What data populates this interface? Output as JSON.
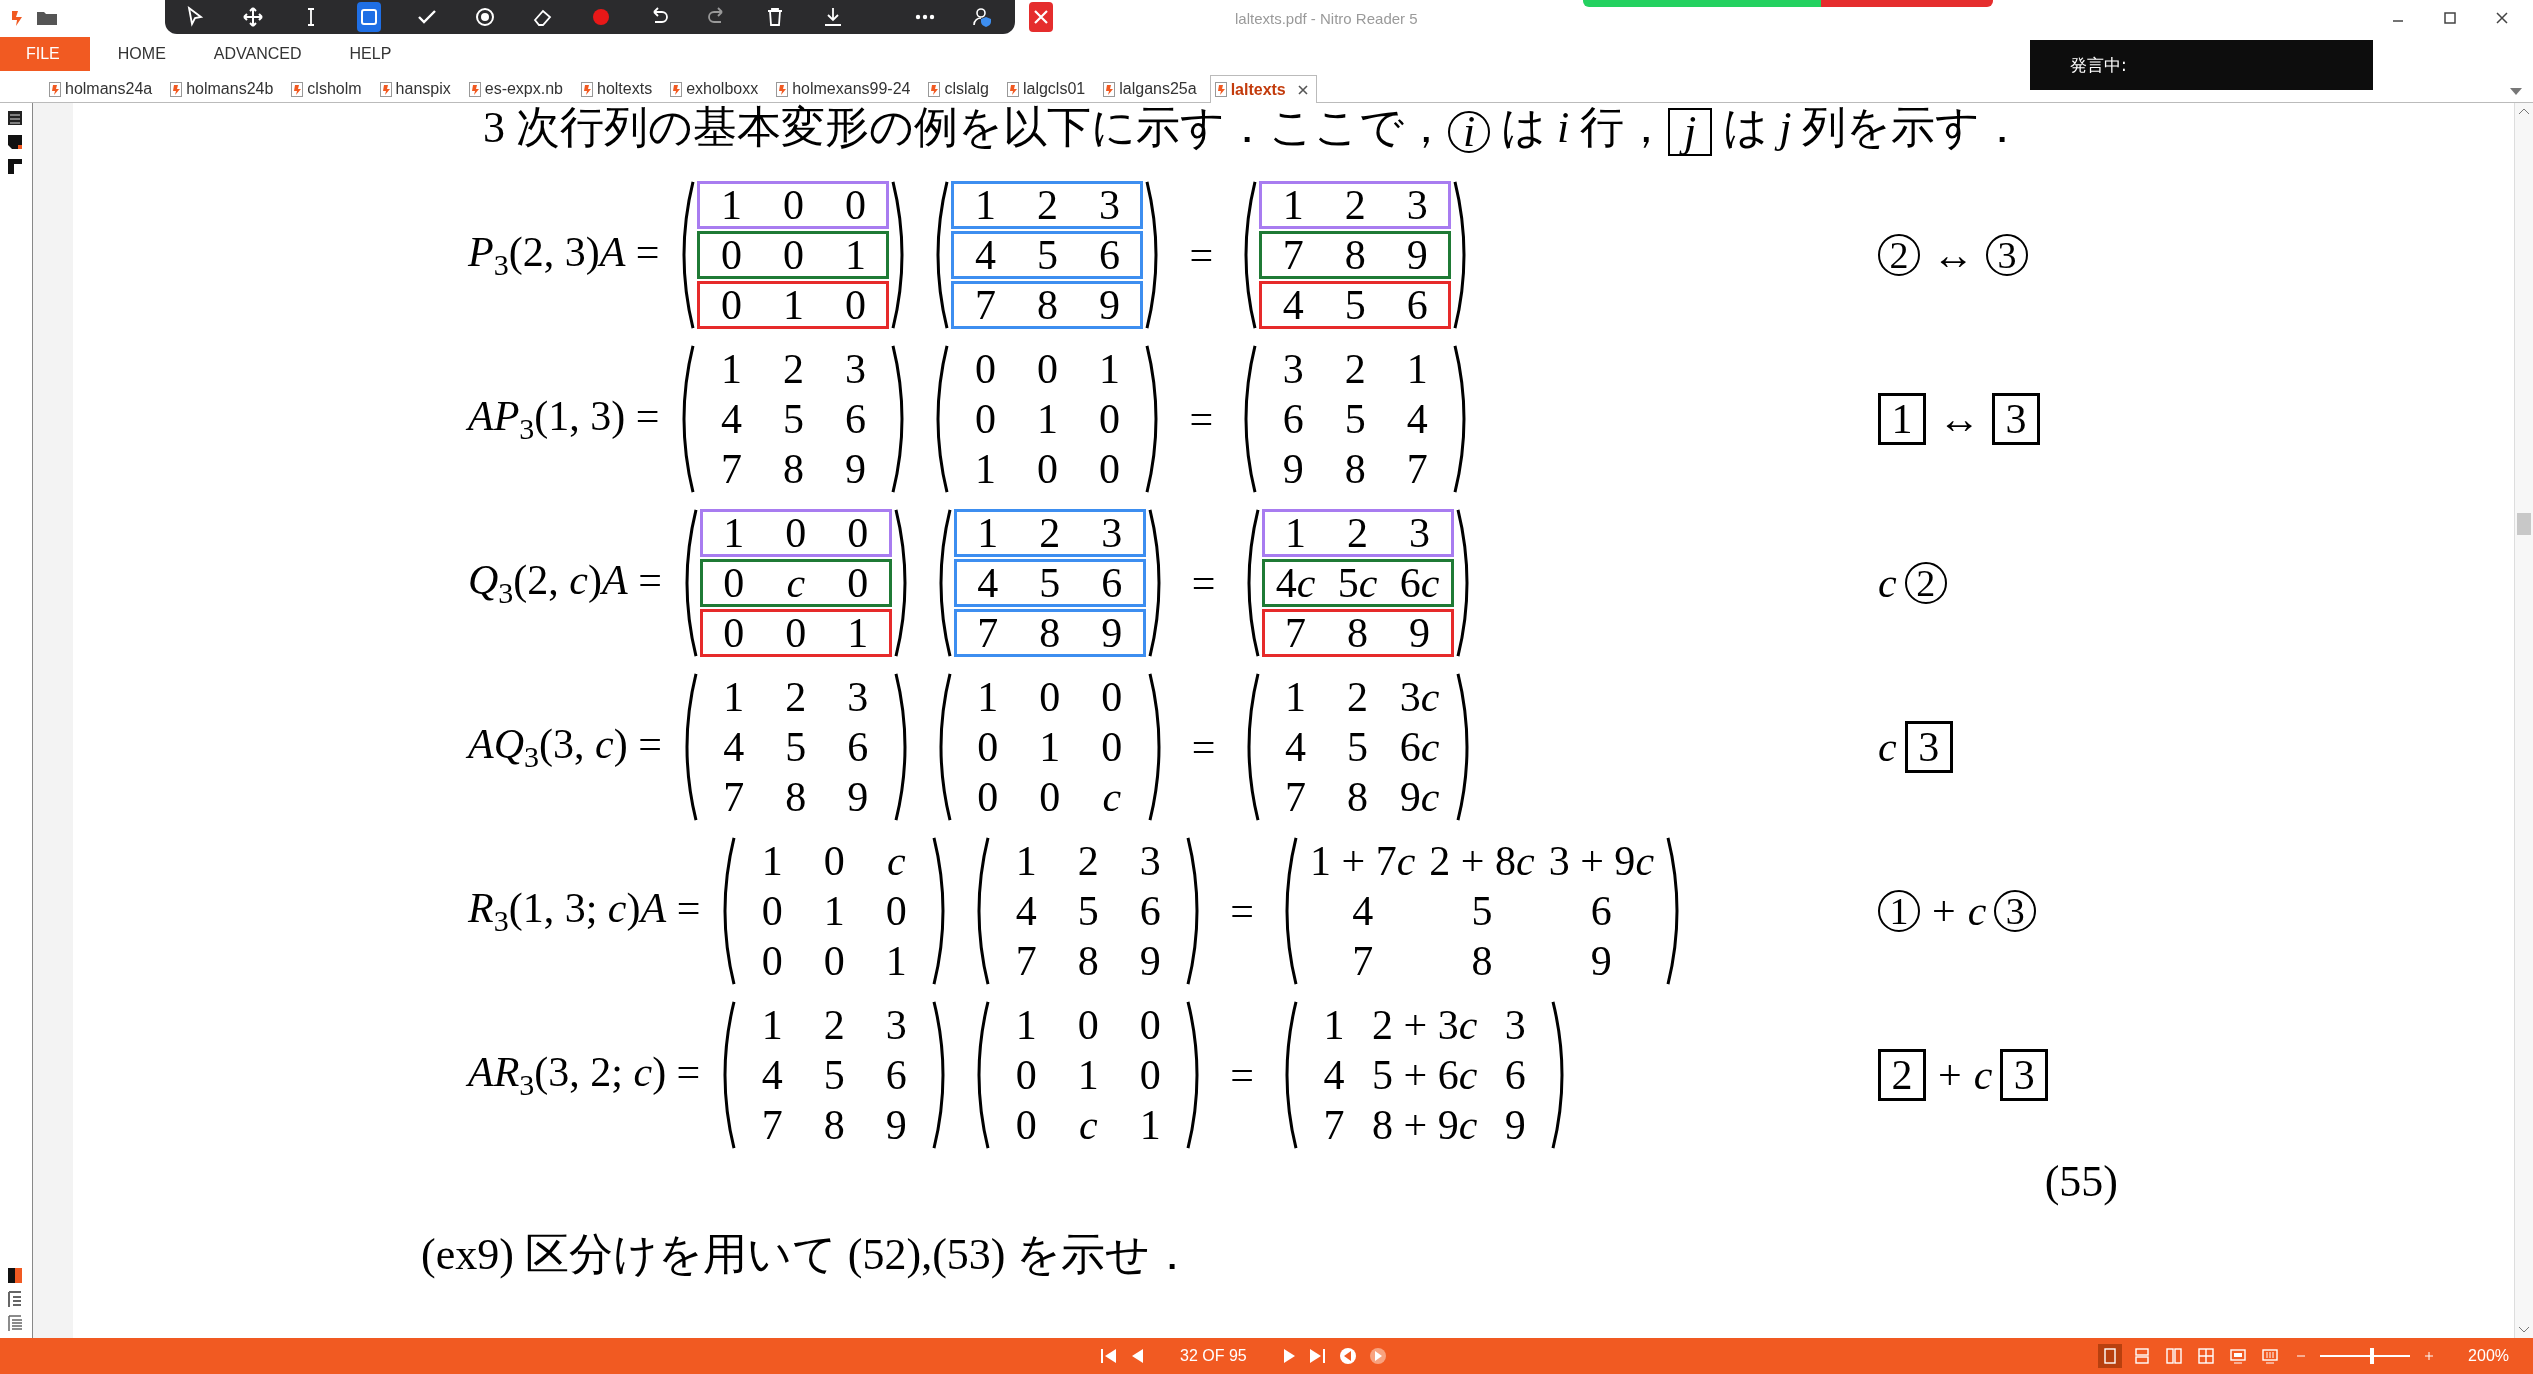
{
  "window": {
    "title": "laltexts.pdf - Nitro Reader 5"
  },
  "floating_toolbar": [
    {
      "kind": "pointer",
      "selected": false
    },
    {
      "kind": "move",
      "selected": false
    },
    {
      "kind": "text",
      "selected": false
    },
    {
      "kind": "rectangle",
      "selected": true
    },
    {
      "kind": "check",
      "selected": false
    },
    {
      "kind": "target",
      "selected": false
    },
    {
      "kind": "eraser",
      "selected": false
    },
    {
      "kind": "dot",
      "selected": false
    },
    {
      "kind": "undo",
      "selected": false
    },
    {
      "kind": "redo",
      "selected": false
    },
    {
      "kind": "trash",
      "selected": false
    },
    {
      "kind": "download",
      "selected": false
    },
    {
      "kind": "more",
      "selected": false
    },
    {
      "kind": "user",
      "selected": false
    }
  ],
  "menu": [
    {
      "label": "FILE",
      "selected": true
    },
    {
      "label": "HOME",
      "selected": false
    },
    {
      "label": "ADVANCED",
      "selected": false
    },
    {
      "label": "HELP",
      "selected": false
    }
  ],
  "tabs": [
    {
      "label": "holmans24a",
      "selected": false
    },
    {
      "label": "holmans24b",
      "selected": false
    },
    {
      "label": "clsholm",
      "selected": false
    },
    {
      "label": "hanspix",
      "selected": false
    },
    {
      "label": "es-expx.nb",
      "selected": false
    },
    {
      "label": "holtexts",
      "selected": false
    },
    {
      "label": "exholboxx",
      "selected": false
    },
    {
      "label": "holmexans99-24",
      "selected": false
    },
    {
      "label": "clslalg",
      "selected": false
    },
    {
      "label": "lalgcls01",
      "selected": false
    },
    {
      "label": "lalgans25a",
      "selected": false
    },
    {
      "label": "laltexts",
      "selected": true
    }
  ],
  "speech_status": "発言中:",
  "intro": [
    {
      "kind": "text",
      "text": "3 次行列の基本変形の例を以下に示す．ここで，"
    },
    {
      "kind": "circled",
      "text": "i"
    },
    {
      "kind": "text",
      "text": " は *i* 行，"
    },
    {
      "kind": "boxed",
      "text": "j"
    },
    {
      "kind": "text",
      "text": " は *j* 列を示す．"
    }
  ],
  "equations": [
    {
      "lhs": "*P*$_{3}$(2, 3)*A* =",
      "relation": "=",
      "matrices": [
        {
          "rows": [
            {
              "cells": [
                "1",
                "0",
                "0"
              ],
              "color": "#a87cf0"
            },
            {
              "cells": [
                "0",
                "0",
                "1"
              ],
              "color": "#1f7a35"
            },
            {
              "cells": [
                "0",
                "1",
                "0"
              ],
              "color": "#e62a2a"
            }
          ]
        },
        {
          "rows": [
            {
              "cells": [
                "1",
                "2",
                "3"
              ],
              "color": "#3d8ef0"
            },
            {
              "cells": [
                "4",
                "5",
                "6"
              ],
              "color": "#3d8ef0"
            },
            {
              "cells": [
                "7",
                "8",
                "9"
              ],
              "color": "#3d8ef0"
            }
          ]
        },
        {
          "rows": [
            {
              "cells": [
                "1",
                "2",
                "3"
              ],
              "color": "#a87cf0"
            },
            {
              "cells": [
                "7",
                "8",
                "9"
              ],
              "color": "#1f7a35"
            },
            {
              "cells": [
                "4",
                "5",
                "6"
              ],
              "color": "#e62a2a"
            }
          ]
        }
      ],
      "note": [
        {
          "kind": "circled",
          "text": "2"
        },
        {
          "kind": "op",
          "text": "↔"
        },
        {
          "kind": "circled",
          "text": "3"
        }
      ]
    },
    {
      "lhs": "*AP*$_{3}$(1, 3) =",
      "relation": "=",
      "matrices": [
        {
          "rows": [
            {
              "cells": [
                "1",
                "2",
                "3"
              ]
            },
            {
              "cells": [
                "4",
                "5",
                "6"
              ]
            },
            {
              "cells": [
                "7",
                "8",
                "9"
              ]
            }
          ]
        },
        {
          "rows": [
            {
              "cells": [
                "0",
                "0",
                "1"
              ]
            },
            {
              "cells": [
                "0",
                "1",
                "0"
              ]
            },
            {
              "cells": [
                "1",
                "0",
                "0"
              ]
            }
          ]
        },
        {
          "rows": [
            {
              "cells": [
                "3",
                "2",
                "1"
              ]
            },
            {
              "cells": [
                "6",
                "5",
                "4"
              ]
            },
            {
              "cells": [
                "9",
                "8",
                "7"
              ]
            }
          ]
        }
      ],
      "note": [
        {
          "kind": "boxed",
          "text": "1"
        },
        {
          "kind": "op",
          "text": "↔"
        },
        {
          "kind": "boxed",
          "text": "3"
        }
      ]
    },
    {
      "lhs": "*Q*$_{3}$(2, *c*)*A* =",
      "relation": "=",
      "matrices": [
        {
          "rows": [
            {
              "cells": [
                "1",
                "0",
                "0"
              ],
              "color": "#a87cf0"
            },
            {
              "cells": [
                "0",
                "c",
                "0"
              ],
              "color": "#1f7a35"
            },
            {
              "cells": [
                "0",
                "0",
                "1"
              ],
              "color": "#e62a2a"
            }
          ]
        },
        {
          "rows": [
            {
              "cells": [
                "1",
                "2",
                "3"
              ],
              "color": "#3d8ef0"
            },
            {
              "cells": [
                "4",
                "5",
                "6"
              ],
              "color": "#3d8ef0"
            },
            {
              "cells": [
                "7",
                "8",
                "9"
              ],
              "color": "#3d8ef0"
            }
          ]
        },
        {
          "rows": [
            {
              "cells": [
                "1",
                "2",
                "3"
              ],
              "color": "#a87cf0"
            },
            {
              "cells": [
                "4c",
                "5c",
                "6c"
              ],
              "color": "#1f7a35"
            },
            {
              "cells": [
                "7",
                "8",
                "9"
              ],
              "color": "#e62a2a"
            }
          ]
        }
      ],
      "note": [
        {
          "kind": "var",
          "text": "c"
        },
        {
          "kind": "circled",
          "text": "2"
        }
      ]
    },
    {
      "lhs": "*AQ*$_{3}$(3, *c*) =",
      "relation": "=",
      "matrices": [
        {
          "rows": [
            {
              "cells": [
                "1",
                "2",
                "3"
              ]
            },
            {
              "cells": [
                "4",
                "5",
                "6"
              ]
            },
            {
              "cells": [
                "7",
                "8",
                "9"
              ]
            }
          ]
        },
        {
          "rows": [
            {
              "cells": [
                "1",
                "0",
                "0"
              ]
            },
            {
              "cells": [
                "0",
                "1",
                "0"
              ]
            },
            {
              "cells": [
                "0",
                "0",
                "c"
              ]
            }
          ]
        },
        {
          "rows": [
            {
              "cells": [
                "1",
                "2",
                "3c"
              ]
            },
            {
              "cells": [
                "4",
                "5",
                "6c"
              ]
            },
            {
              "cells": [
                "7",
                "8",
                "9c"
              ]
            }
          ]
        }
      ],
      "note": [
        {
          "kind": "var",
          "text": "c"
        },
        {
          "kind": "boxed",
          "text": "3"
        }
      ]
    },
    {
      "lhs": "*R*$_{3}$(1, 3; *c*)*A* =",
      "relation": "=",
      "matrices": [
        {
          "rows": [
            {
              "cells": [
                "1",
                "0",
                "c"
              ]
            },
            {
              "cells": [
                "0",
                "1",
                "0"
              ]
            },
            {
              "cells": [
                "0",
                "0",
                "1"
              ]
            }
          ]
        },
        {
          "rows": [
            {
              "cells": [
                "1",
                "2",
                "3"
              ]
            },
            {
              "cells": [
                "4",
                "5",
                "6"
              ]
            },
            {
              "cells": [
                "7",
                "8",
                "9"
              ]
            }
          ]
        },
        {
          "rows": [
            {
              "cells": [
                "1 + 7c",
                "2 + 8c",
                "3 + 9c"
              ]
            },
            {
              "cells": [
                "4",
                "5",
                "6"
              ]
            },
            {
              "cells": [
                "7",
                "8",
                "9"
              ]
            }
          ]
        }
      ],
      "note": [
        {
          "kind": "circled",
          "text": "1"
        },
        {
          "kind": "op",
          "text": "+"
        },
        {
          "kind": "var",
          "text": "c"
        },
        {
          "kind": "circled",
          "text": "3"
        }
      ]
    },
    {
      "lhs": "*AR*$_{3}$(3, 2; *c*) =",
      "relation": "=",
      "matrices": [
        {
          "rows": [
            {
              "cells": [
                "1",
                "2",
                "3"
              ]
            },
            {
              "cells": [
                "4",
                "5",
                "6"
              ]
            },
            {
              "cells": [
                "7",
                "8",
                "9"
              ]
            }
          ]
        },
        {
          "rows": [
            {
              "cells": [
                "1",
                "0",
                "0"
              ]
            },
            {
              "cells": [
                "0",
                "1",
                "0"
              ]
            },
            {
              "cells": [
                "0",
                "c",
                "1"
              ]
            }
          ]
        },
        {
          "rows": [
            {
              "cells": [
                "1",
                "2 + 3c",
                "3"
              ]
            },
            {
              "cells": [
                "4",
                "5 + 6c",
                "6"
              ]
            },
            {
              "cells": [
                "7",
                "8 + 9c",
                "9"
              ]
            }
          ]
        }
      ],
      "note": [
        {
          "kind": "boxed",
          "text": "2"
        },
        {
          "kind": "op",
          "text": "+"
        },
        {
          "kind": "var",
          "text": "c"
        },
        {
          "kind": "boxed",
          "text": "3"
        }
      ]
    }
  ],
  "equation_number": "(55)",
  "exercise": "(ex9) 区分けを用いて (52),(53) を示せ．",
  "status_bar": {
    "page": "32 OF 95",
    "views": [
      {
        "kind": "single",
        "selected": true
      },
      {
        "kind": "continuous",
        "selected": false
      },
      {
        "kind": "facing",
        "selected": false
      },
      {
        "kind": "facing-continuous",
        "selected": false
      },
      {
        "kind": "cover",
        "selected": false
      },
      {
        "kind": "cover-continuous",
        "selected": false
      }
    ],
    "zoom_slider": {
      "level": 0.58
    },
    "zoom": "200%"
  }
}
